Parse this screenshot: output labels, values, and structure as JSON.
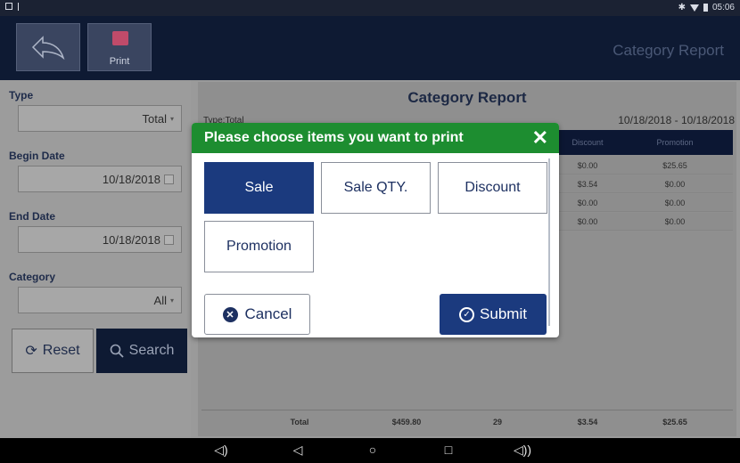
{
  "status_bar": {
    "time": "05:06"
  },
  "header": {
    "back_icon": "back-arrow-icon",
    "print_icon": "printer-icon",
    "print_label": "Print",
    "title": "Category Report"
  },
  "filters": {
    "type_label": "Type",
    "type_value": "Total",
    "begin_label": "Begin Date",
    "begin_value": "10/18/2018",
    "end_label": "End Date",
    "end_value": "10/18/2018",
    "category_label": "Category",
    "category_value": "All",
    "reset_label": "Reset",
    "search_label": "Search"
  },
  "report": {
    "title": "Category Report",
    "type_text": "Type:Total",
    "date_range": "10/18/2018 - 10/18/2018",
    "columns": [
      "Discount",
      "Promotion"
    ],
    "rows": [
      {
        "discount": "$0.00",
        "promotion": "$25.65"
      },
      {
        "discount": "$3.54",
        "promotion": "$0.00"
      },
      {
        "discount": "$0.00",
        "promotion": "$0.00"
      },
      {
        "discount": "$0.00",
        "promotion": "$0.00"
      }
    ],
    "totals": {
      "label": "Total",
      "sale": "$459.80",
      "qty": "29",
      "discount": "$3.54",
      "promotion": "$25.65"
    }
  },
  "modal": {
    "title": "Please choose items you want to print",
    "options": [
      "Sale",
      "Sale QTY.",
      "Discount",
      "Promotion"
    ],
    "selected": "Sale",
    "cancel_label": "Cancel",
    "submit_label": "Submit"
  },
  "colors": {
    "header_bg": "#0e1a33",
    "modal_header": "#1d8d30",
    "primary": "#1b3a7e"
  }
}
